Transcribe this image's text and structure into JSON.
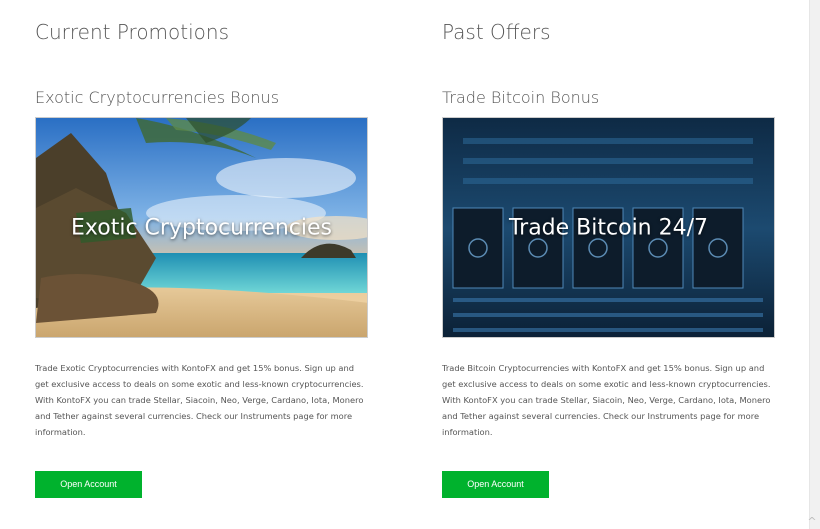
{
  "left_column": {
    "section_title": "Current Promotions",
    "promo_title": "Exotic Cryptocurrencies Bonus",
    "image_caption": "Exotic Cryptocurrencies",
    "description": "Trade Exotic Cryptocurrencies with KontoFX and get 15% bonus. Sign up and get exclusive access to deals on some exotic and less-known cryptocurrencies. With KontoFX you can trade Stellar, Siacoin, Neo, Verge, Cardano, Iota, Monero and Tether against several currencies. Check our Instruments page for more information.",
    "button_label": "Open Account"
  },
  "right_column": {
    "section_title": "Past Offers",
    "promo_title": "Trade Bitcoin Bonus",
    "image_caption": "Trade Bitcoin 24/7",
    "description": "Trade Bitcoin Cryptocurrencies with KontoFX and get 15% bonus. Sign up and get exclusive access to deals on some exotic and less-known cryptocurrencies. With KontoFX you can trade Stellar, Siacoin, Neo, Verge, Cardano, Iota, Monero and Tether against several currencies. Check our Instruments page for more information.",
    "button_label": "Open Account"
  },
  "colors": {
    "button_green": "#00b22d",
    "heading_gray": "#555555"
  }
}
